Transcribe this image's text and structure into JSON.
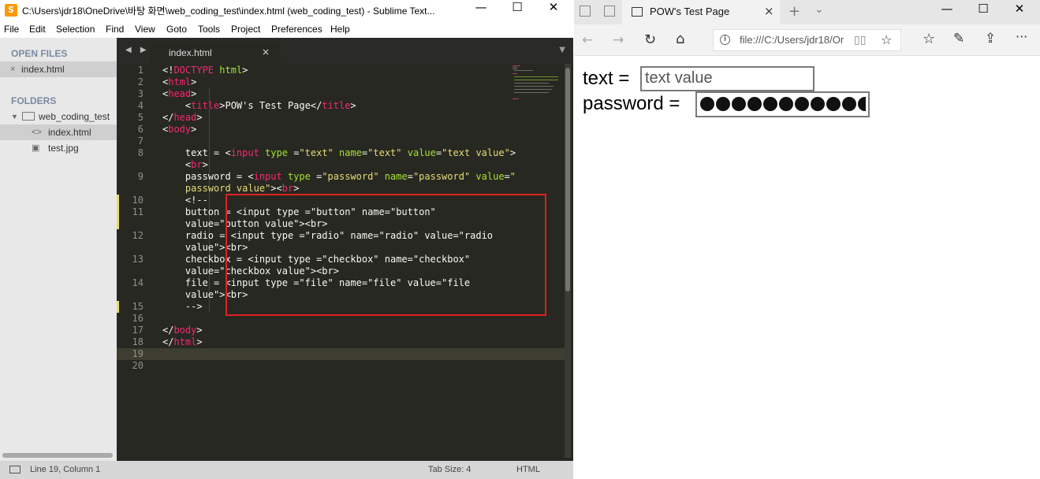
{
  "sublime": {
    "title": "C:\\Users\\jdr18\\OneDrive\\바탕 화면\\web_coding_test\\index.html (web_coding_test) - Sublime Text...",
    "app_icon": "sublime-logo",
    "menu": [
      "File",
      "Edit",
      "Selection",
      "Find",
      "View",
      "Goto",
      "Tools",
      "Project",
      "Preferences",
      "Help"
    ],
    "sidebar": {
      "open_files_heading": "OPEN FILES",
      "open_files": [
        {
          "name": "index.html",
          "close_glyph": "×"
        }
      ],
      "folders_heading": "FOLDERS",
      "folder": {
        "name": "web_coding_test",
        "expanded": true
      },
      "files": [
        {
          "name": "index.html",
          "icon": "code-file-icon",
          "glyph": "<>",
          "active": true
        },
        {
          "name": "test.jpg",
          "icon": "image-file-icon",
          "glyph": "▣",
          "active": false
        }
      ]
    },
    "tab": {
      "label": "index.html",
      "close_glyph": "×",
      "nav_glyph": "◀ ▶",
      "menu_glyph": "▼"
    },
    "line_numbers": [
      "1",
      "2",
      "3",
      "4",
      "5",
      "6",
      "7",
      "8",
      "9",
      "10",
      "11",
      "12",
      "13",
      "14",
      "15",
      "16",
      "17",
      "18",
      "19",
      "20"
    ],
    "status": {
      "position": "Line 19, Column 1",
      "tab_size": "Tab Size: 4",
      "syntax": "HTML"
    },
    "colors": {
      "background": "#272822",
      "tag": "#f92672",
      "attribute": "#a6e22e",
      "string": "#e6db74",
      "comment": "#75715e",
      "highlight_box": "#e22020"
    }
  },
  "browser": {
    "tab_title": "POW's Test Page",
    "tab_close": "×",
    "new_tab": "+",
    "tab_list": "⌄",
    "url": "file:///C:/Users/jdr18/Or",
    "window_buttons": [
      "—",
      "☐",
      "✕"
    ],
    "toolbar_icons": [
      "back-icon",
      "forward-icon",
      "refresh-icon",
      "home-icon",
      "favorites-icon",
      "notes-icon",
      "share-icon",
      "more-icon"
    ],
    "toolbar_glyphs": {
      "back": "←",
      "forward": "→",
      "refresh": "↻",
      "home": "⌂",
      "favorites": "☆",
      "notes": "✎",
      "share": "⇪",
      "more": "···",
      "reading": "📖",
      "star": "☆",
      "info": "i"
    },
    "page": {
      "text_label": "text =",
      "text_value": "text value",
      "password_label": "password =",
      "password_value": "password value",
      "password_dots_visible": 11
    }
  }
}
